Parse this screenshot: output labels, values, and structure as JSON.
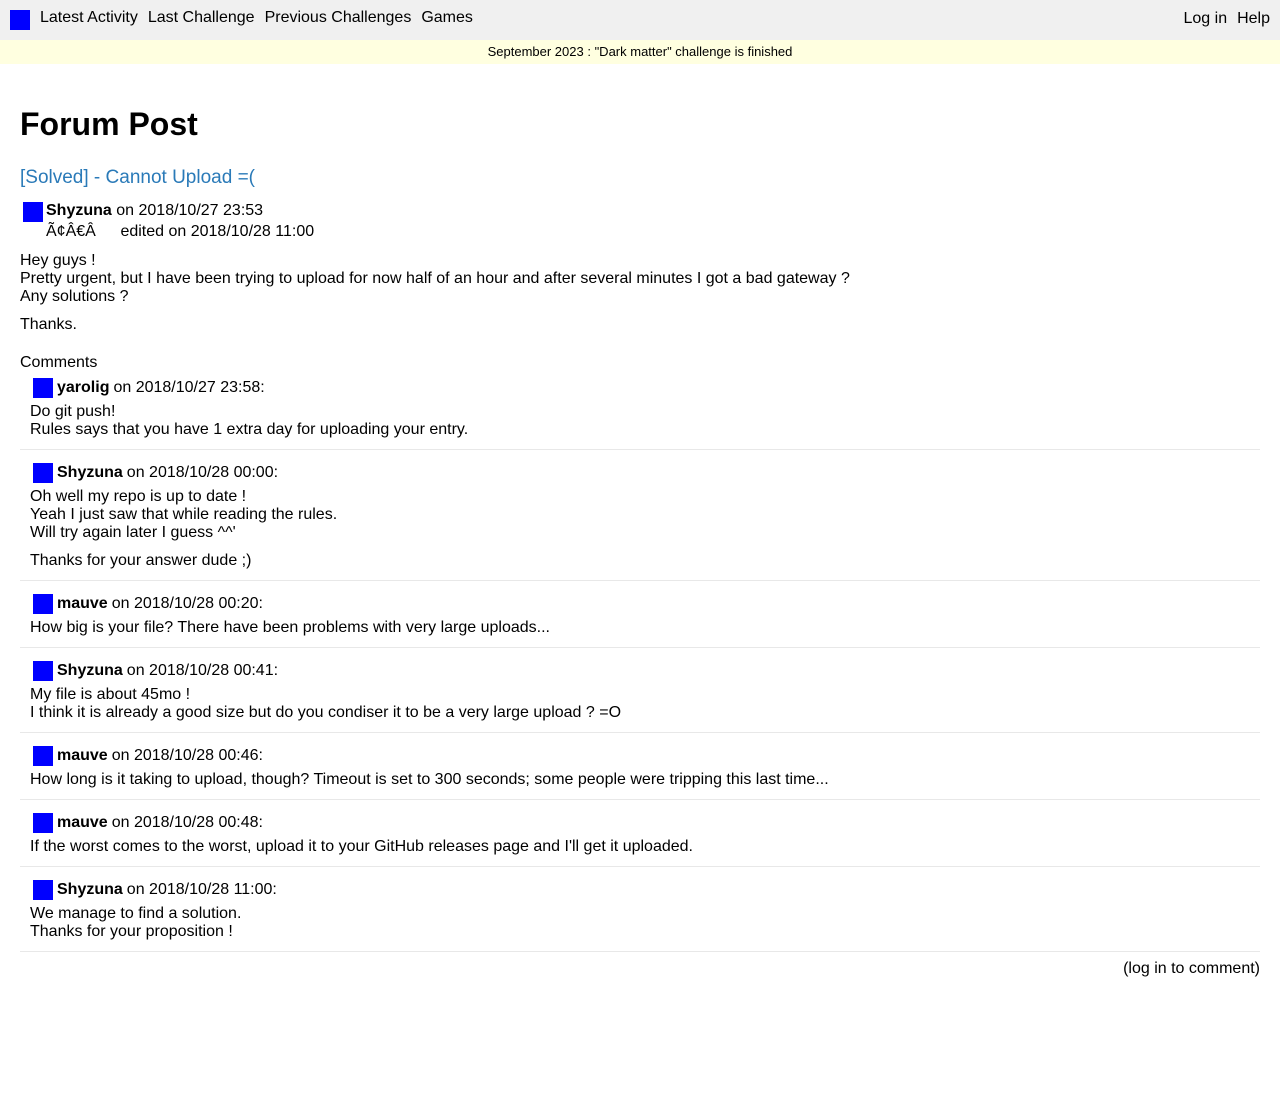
{
  "nav": {
    "logo_color": "#0000ff",
    "left": [
      "Latest Activity",
      "Last Challenge",
      "Previous Challenges",
      "Games"
    ],
    "right": [
      "Log in",
      "Help"
    ]
  },
  "banner": "September 2023 : \"Dark matter\" challenge is finished",
  "page_title": "Forum Post",
  "post": {
    "title": "[Solved] - Cannot Upload =(",
    "author": "Shyzuna",
    "posted": "on 2018/10/27 23:53",
    "garbled": "Ã¢Â€Â",
    "edited": "edited on 2018/10/28 11:00",
    "body": [
      "Hey guys !\nPretty urgent, but I have been trying to upload for now half of an hour and after several minutes I got a bad gateway ?\nAny solutions ?",
      "Thanks."
    ]
  },
  "comments_heading": "Comments",
  "comments": [
    {
      "author": "yarolig",
      "meta": "on 2018/10/27 23:58:",
      "paragraphs": [
        "Do git push!\nRules says that you have 1 extra day for uploading your entry."
      ]
    },
    {
      "author": "Shyzuna",
      "meta": "on 2018/10/28 00:00:",
      "paragraphs": [
        "Oh well my repo is up to date !\nYeah I just saw that while reading the rules.\nWill try again later I guess ^^'",
        "Thanks for your answer dude ;)"
      ]
    },
    {
      "author": "mauve",
      "meta": "on 2018/10/28 00:20:",
      "paragraphs": [
        "How big is your file? There have been problems with very large uploads..."
      ]
    },
    {
      "author": "Shyzuna",
      "meta": "on 2018/10/28 00:41:",
      "paragraphs": [
        "My file is about 45mo !\nI think it is already a good size but do you condiser it to be a very large upload ? =O"
      ]
    },
    {
      "author": "mauve",
      "meta": "on 2018/10/28 00:46:",
      "paragraphs": [
        "How long is it taking to upload, though? Timeout is set to 300 seconds; some people were tripping this last time..."
      ]
    },
    {
      "author": "mauve",
      "meta": "on 2018/10/28 00:48:",
      "paragraphs": [
        "If the worst comes to the worst, upload it to your GitHub releases page and I'll get it uploaded."
      ]
    },
    {
      "author": "Shyzuna",
      "meta": "on 2018/10/28 11:00:",
      "paragraphs": [
        "We manage to find a solution.\nThanks for your proposition !"
      ]
    }
  ],
  "login_to_comment": "(log in to comment)"
}
